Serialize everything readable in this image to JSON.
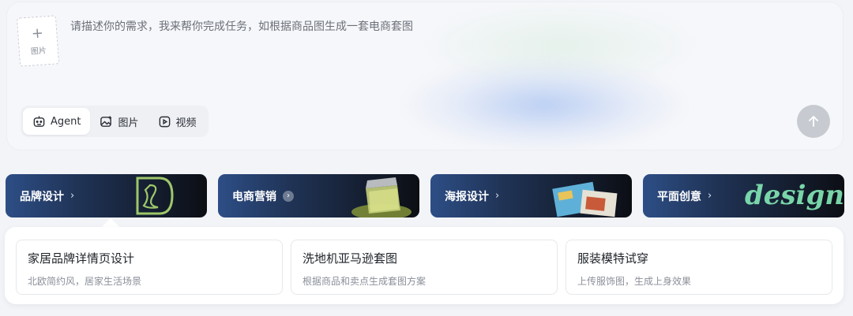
{
  "prompt": {
    "upload_plus": "+",
    "upload_label": "图片",
    "placeholder": "请描述你的需求，我来帮你完成任务，如根据商品图生成一套电商套图"
  },
  "modes": [
    {
      "label": "Agent",
      "icon": "agent-icon",
      "active": true
    },
    {
      "label": "图片",
      "icon": "image-icon",
      "active": false
    },
    {
      "label": "视频",
      "icon": "video-icon",
      "active": false
    }
  ],
  "send": {
    "icon": "arrow-up-icon",
    "color": "#c7cbd1"
  },
  "categories": [
    {
      "label": "品牌设计",
      "chevron": "›"
    },
    {
      "label": "电商营销",
      "chevron": "›"
    },
    {
      "label": "海报设计",
      "chevron": "›"
    },
    {
      "label": "平面创意",
      "chevron": "›",
      "art_text": "design"
    }
  ],
  "suggestions": [
    {
      "title": "家居品牌详情页设计",
      "desc": "北欧简约风，居家生活场景"
    },
    {
      "title": "洗地机亚马逊套图",
      "desc": "根据商品和卖点生成套图方案"
    },
    {
      "title": "服装模特试穿",
      "desc": "上传服饰图，生成上身效果"
    }
  ],
  "colors": {
    "background": "#f2f4f8",
    "category_gradient_start": "#2d4e86",
    "category_gradient_end": "#0c0e14",
    "design_text": "#7fe0b0"
  }
}
